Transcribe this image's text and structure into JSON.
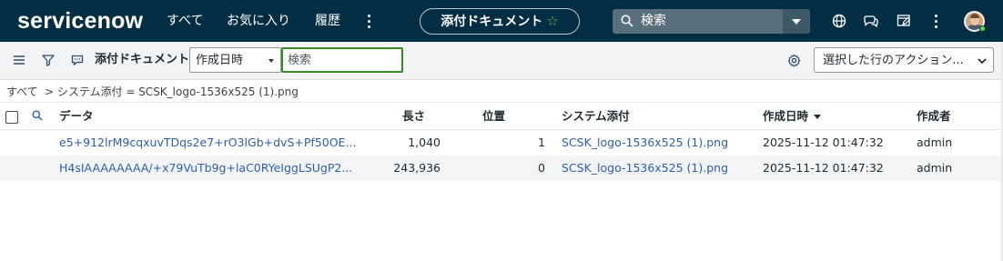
{
  "topnav": {
    "logo": "servicenow",
    "links": [
      "すべて",
      "お気に入り",
      "履歴"
    ],
    "context_title": "添付ドキュメント",
    "search_placeholder": "検索",
    "accent_color": "#62d84e",
    "background_color": "#032d42",
    "icons": [
      "globe-icon",
      "chat-icon",
      "edit-window-icon",
      "more-icon",
      "avatar"
    ]
  },
  "toolbar": {
    "title": "添付ドキュメント",
    "field_select_value": "作成日時",
    "search_placeholder": "検索",
    "action_select_value": "選択した行のアクション..."
  },
  "breadcrumb": {
    "root": "すべて",
    "filter": "> システム添付 = SCSK_logo-1536x525 (1).png"
  },
  "table": {
    "columns": [
      "データ",
      "長さ",
      "位置",
      "システム添付",
      "作成日時",
      "作成者"
    ],
    "sorted_column": "作成日時",
    "rows": [
      {
        "data": "e5+912lrM9cqxuvTDqs2e7+rO3lGb+dvS+Pf50OE...",
        "length": "1,040",
        "position": "1",
        "attachment": "SCSK_logo-1536x525 (1).png",
        "created": "2025-11-12 01:47:32",
        "creator": "admin"
      },
      {
        "data": "H4sIAAAAAAAA/+x79VuTb9g+laC0RYeIggLSUgP2...",
        "length": "243,936",
        "position": "0",
        "attachment": "SCSK_logo-1536x525 (1).png",
        "created": "2025-11-12 01:47:32",
        "creator": "admin"
      }
    ]
  }
}
